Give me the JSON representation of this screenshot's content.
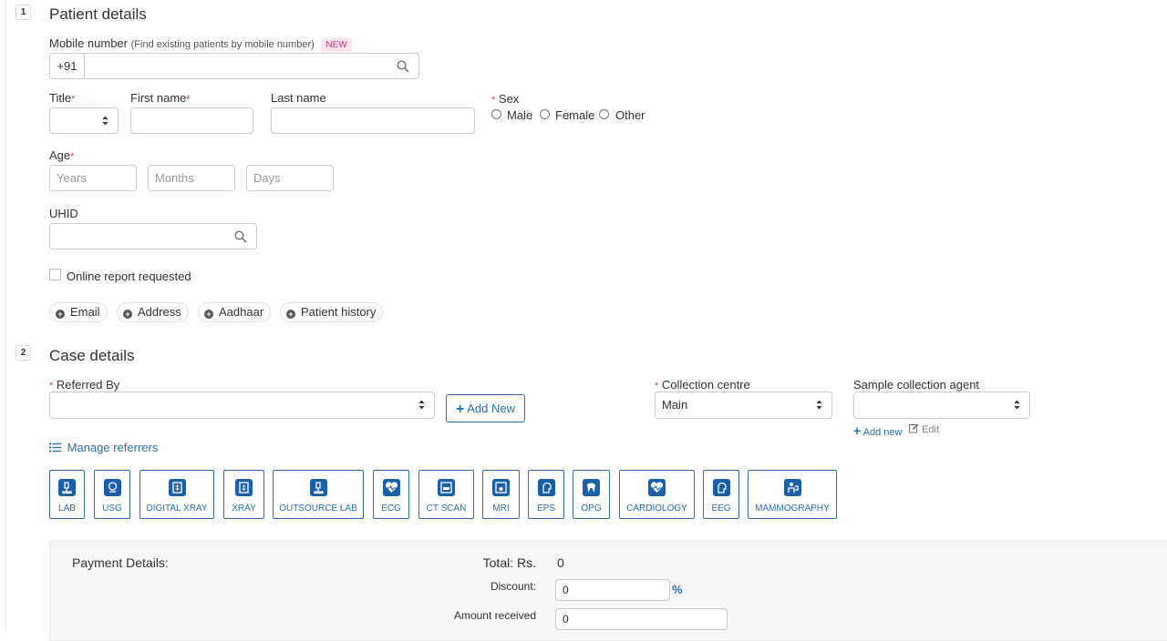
{
  "patient": {
    "step": "1",
    "title": "Patient details",
    "mobile_label": "Mobile number",
    "mobile_hint": "(Find existing patients by mobile number)",
    "mobile_badge": "NEW",
    "mobile_prefix": "+91",
    "mobile_value": "",
    "title_label": "Title",
    "first_name_label": "First name",
    "last_name_label": "Last name",
    "sex_label": "Sex",
    "sex_options": [
      "Male",
      "Female",
      "Other"
    ],
    "age_label": "Age",
    "age_placeholders": [
      "Years",
      "Months",
      "Days"
    ],
    "uhid_label": "UHID",
    "online_report_label": "Online report requested",
    "extra_buttons": [
      "Email",
      "Address",
      "Aadhaar",
      "Patient history"
    ],
    "required_mark": "*"
  },
  "case": {
    "step": "2",
    "title": "Case details",
    "referred_by_label": "Referred By",
    "add_new_label": "Add New",
    "collection_centre_label": "Collection centre",
    "collection_centre_value": "Main",
    "sample_agent_label": "Sample collection agent",
    "agent_add_new": "Add new",
    "agent_edit": "Edit",
    "manage_referrers": "Manage referrers",
    "departments": [
      "LAB",
      "USG",
      "DIGITAL XRAY",
      "XRAY",
      "OUTSOURCE LAB",
      "ECG",
      "CT SCAN",
      "MRI",
      "EPS",
      "OPG",
      "CARDIOLOGY",
      "EEG",
      "MAMMOGRAPHY"
    ]
  },
  "payment": {
    "title": "Payment Details:",
    "total_label": "Total: Rs.",
    "total_value": "0",
    "discount_label": "Discount:",
    "discount_value": "0",
    "discount_unit": "%",
    "amount_received_label": "Amount received",
    "amount_received_value": "0"
  },
  "colors": {
    "accent": "#2f6db5",
    "icon_bg": "#1a5fa8",
    "required": "#e0494e",
    "badge_bg": "#fde4ef",
    "badge_text": "#d63384"
  }
}
